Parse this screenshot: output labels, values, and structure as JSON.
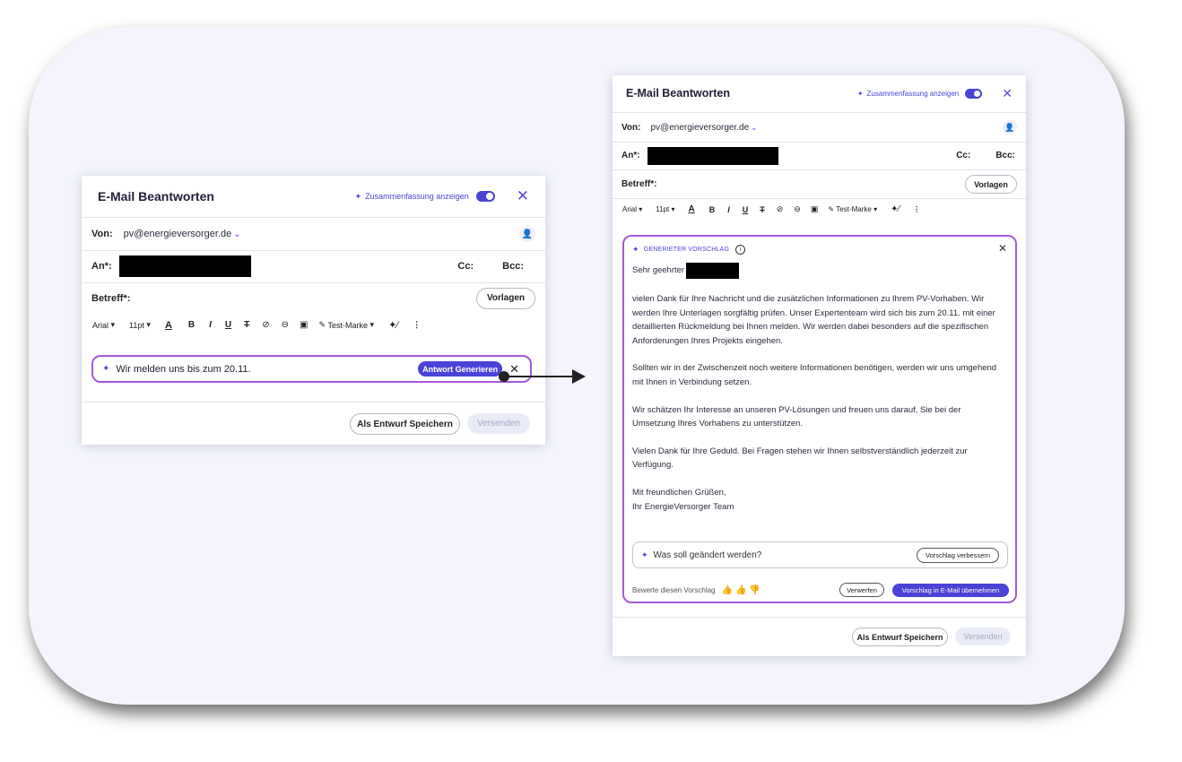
{
  "left": {
    "title": "E-Mail Beantworten",
    "summary_label": "Zusammenfassung anzeigen",
    "von_label": "Von:",
    "von_value": "pv@energieversorger.de",
    "an_label": "An*:",
    "cc_label": "Cc:",
    "bcc_label": "Bcc:",
    "betreff_label": "Betreff*:",
    "vorlagen": "Vorlagen",
    "toolbar": {
      "font": "Arial",
      "size": "11pt",
      "brand": "Test-Marke"
    },
    "prompt_text": "Wir melden uns bis zum 20.11.",
    "generate": "Antwort Generieren",
    "draft": "Als Entwurf Speichern",
    "send": "Versenden"
  },
  "right": {
    "title": "E-Mail Beantworten",
    "summary_label": "Zusammenfassung anzeigen",
    "von_label": "Von:",
    "von_value": "pv@energieversorger.de",
    "an_label": "An*:",
    "cc_label": "Cc:",
    "bcc_label": "Bcc:",
    "betreff_label": "Betreff*:",
    "vorlagen": "Vorlagen",
    "toolbar": {
      "font": "Arial",
      "size": "11pt",
      "brand": "Test-Marke"
    },
    "suggestion_label": "GENERIETER VORSCHLAG",
    "greeting": "Sehr geehrter",
    "paragraphs": [
      "vielen Dank für Ihre Nachricht und die zusätzlichen Informationen zu Ihrem PV-Vorhaben. Wir werden Ihre Unterlagen sorgfältig prüfen. Unser Expertenteam wird sich bis zum 20.11. mit einer detaillierten Rückmeldung bei Ihnen melden. Wir werden dabei besonders auf die spezifischen Anforderungen Ihres Projekts eingehen.",
      "Sollten wir in der Zwischenzeit noch weitere Informationen benötigen, werden wir uns umgehend mit Ihnen in Verbindung setzen.",
      "Wir schätzen Ihr Interesse an unseren PV-Lösungen und freuen uns darauf, Sie bei der Umsetzung Ihres Vorhabens zu unterstützen.",
      "Vielen Dank für Ihre Geduld. Bei Fragen stehen wir Ihnen selbstverständlich jederzeit zur Verfügung."
    ],
    "closing1": "Mit freundlichen Grüßen,",
    "closing2": "Ihr EnergieVersorger Team",
    "refine_placeholder": "Was soll geändert werden?",
    "improve": "Vorschlag verbessern",
    "rate_label": "Bewerte diesen Vorschlag",
    "discard": "Verwerfen",
    "apply": "Vorschlag in E-Mail übernehmen",
    "draft": "Als Entwurf Speichern",
    "send": "Versenden"
  },
  "colors": {
    "accent": "#4a43d6",
    "highlight": "#a45ad8"
  }
}
